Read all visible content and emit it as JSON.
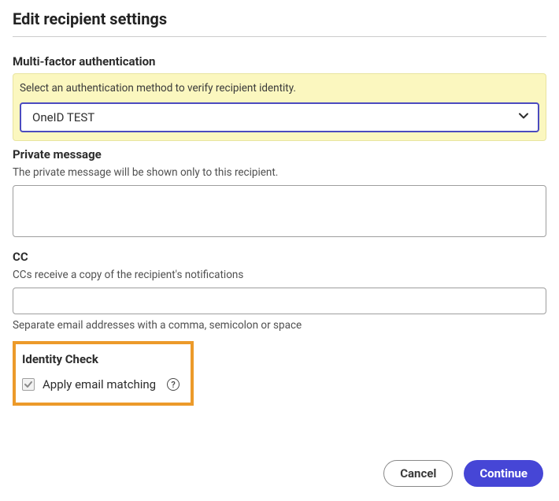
{
  "dialog": {
    "title": "Edit recipient settings"
  },
  "mfa": {
    "label": "Multi-factor authentication",
    "hint": "Select an authentication method to verify recipient identity.",
    "selected": "OneID TEST"
  },
  "privateMessage": {
    "label": "Private message",
    "hint": "The private message will be shown only to this recipient.",
    "value": ""
  },
  "cc": {
    "label": "CC",
    "hint": "CCs receive a copy of the recipient's notifications",
    "value": "",
    "helper": "Separate email addresses with a comma, semicolon or space"
  },
  "identity": {
    "label": "Identity Check",
    "checkbox_label": "Apply email matching",
    "checked": true
  },
  "footer": {
    "cancel": "Cancel",
    "continue": "Continue"
  }
}
